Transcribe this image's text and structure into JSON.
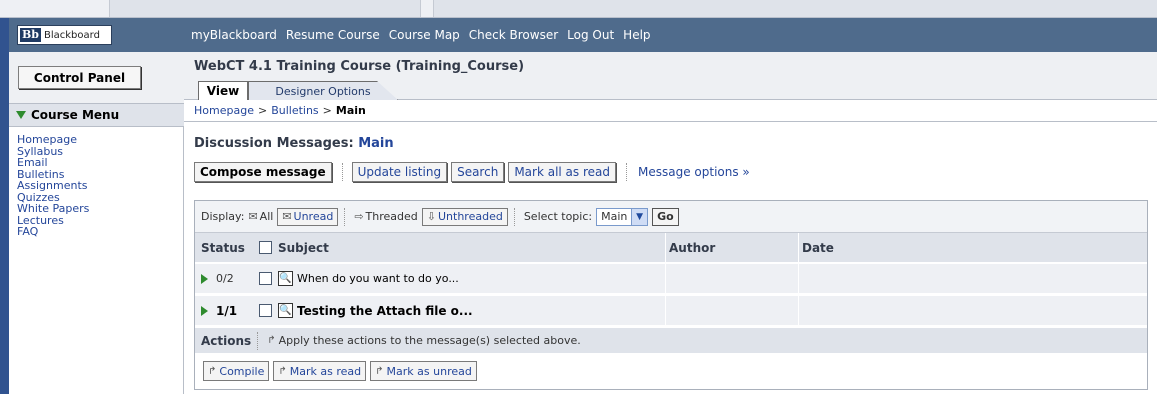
{
  "header": {
    "logo_text": "Blackboard",
    "logo_mark": "Bb",
    "nav": [
      "myBlackboard",
      "Resume Course",
      "Course Map",
      "Check Browser",
      "Log Out",
      "Help"
    ]
  },
  "sidebar": {
    "control_panel": "Control Panel",
    "course_menu": "Course Menu",
    "items": [
      "Homepage",
      "Syllabus",
      "Email",
      "Bulletins",
      "Assignments",
      "Quizzes",
      "White Papers",
      "Lectures",
      "FAQ"
    ]
  },
  "course": {
    "title": "WebCT 4.1 Training Course  (Training_Course)",
    "tabs": [
      "View",
      "Designer Options"
    ]
  },
  "breadcrumb": {
    "items": [
      "Homepage",
      "Bulletins",
      "Main"
    ],
    "sep": ">"
  },
  "discussion": {
    "title_prefix": "Discussion Messages:",
    "topic": "Main",
    "buttons": [
      "Compose message",
      "Update listing",
      "Search",
      "Mark all as read"
    ],
    "message_options": "Message options »"
  },
  "display": {
    "label": "Display:",
    "all": "All",
    "unread": "Unread",
    "threaded": "Threaded",
    "unthreaded": "Unthreaded",
    "select_topic_label": "Select topic:",
    "select_topic_value": "Main",
    "go": "Go"
  },
  "table": {
    "columns": [
      "Status",
      "Subject",
      "Author",
      "Date"
    ],
    "rows": [
      {
        "status": "0/2",
        "subject": "When do you want to do yo...",
        "author": "",
        "date": "",
        "bold": false
      },
      {
        "status": "1/1",
        "subject": "Testing the Attach file o...",
        "author": "",
        "date": "",
        "bold": true
      }
    ]
  },
  "actions": {
    "label": "Actions",
    "text": "Apply these actions to the message(s) selected above.",
    "buttons": [
      "Compile",
      "Mark as read",
      "Mark as unread"
    ]
  },
  "colors": {
    "header_bg": "#4f6b8c",
    "link": "#24469a",
    "accent_green": "#2e8b2e"
  }
}
